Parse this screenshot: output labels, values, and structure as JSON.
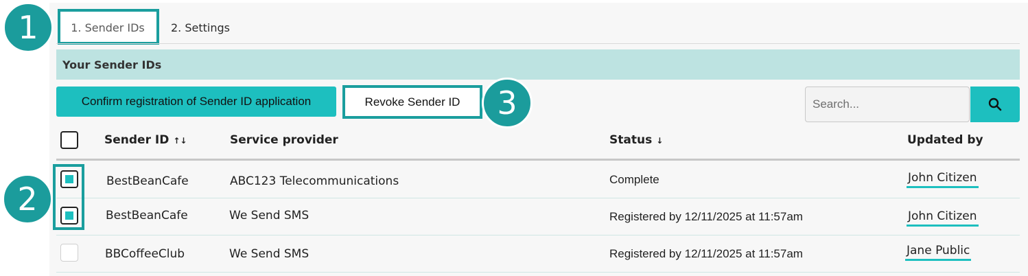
{
  "tabs": [
    {
      "label": "1. Sender IDs",
      "active": true
    },
    {
      "label": "2. Settings",
      "active": false
    }
  ],
  "section_title": "Your Sender IDs",
  "actions": {
    "confirm_label": "Confirm registration of Sender ID application",
    "revoke_label": "Revoke Sender ID"
  },
  "search": {
    "placeholder": "Search...",
    "value": "",
    "icon": "search-icon"
  },
  "table": {
    "headers": {
      "sender_id": "Sender ID",
      "sender_id_sort": "↑↓",
      "service_provider": "Service provider",
      "status": "Status",
      "status_sort": "↓",
      "updated_by": "Updated by"
    },
    "rows": [
      {
        "sender_id": "BestBeanCafe",
        "service_provider": "ABC123 Telecommunications",
        "status": "Complete",
        "updated_by": "John Citizen",
        "checked": true
      },
      {
        "sender_id": "BestBeanCafe",
        "service_provider": "We Send SMS",
        "status": "Registered by 12/11/2025 at 11:57am",
        "updated_by": "John Citizen",
        "checked": true
      },
      {
        "sender_id": "BBCoffeeClub",
        "service_provider": "We Send SMS",
        "status": "Registered by 12/11/2025 at 11:57am",
        "updated_by": "Jane Public",
        "checked": false
      }
    ]
  },
  "callouts": [
    "1",
    "2",
    "3"
  ],
  "colors": {
    "accent": "#1dbfbf",
    "callout": "#1b9c9c",
    "band": "#bde3e1"
  }
}
